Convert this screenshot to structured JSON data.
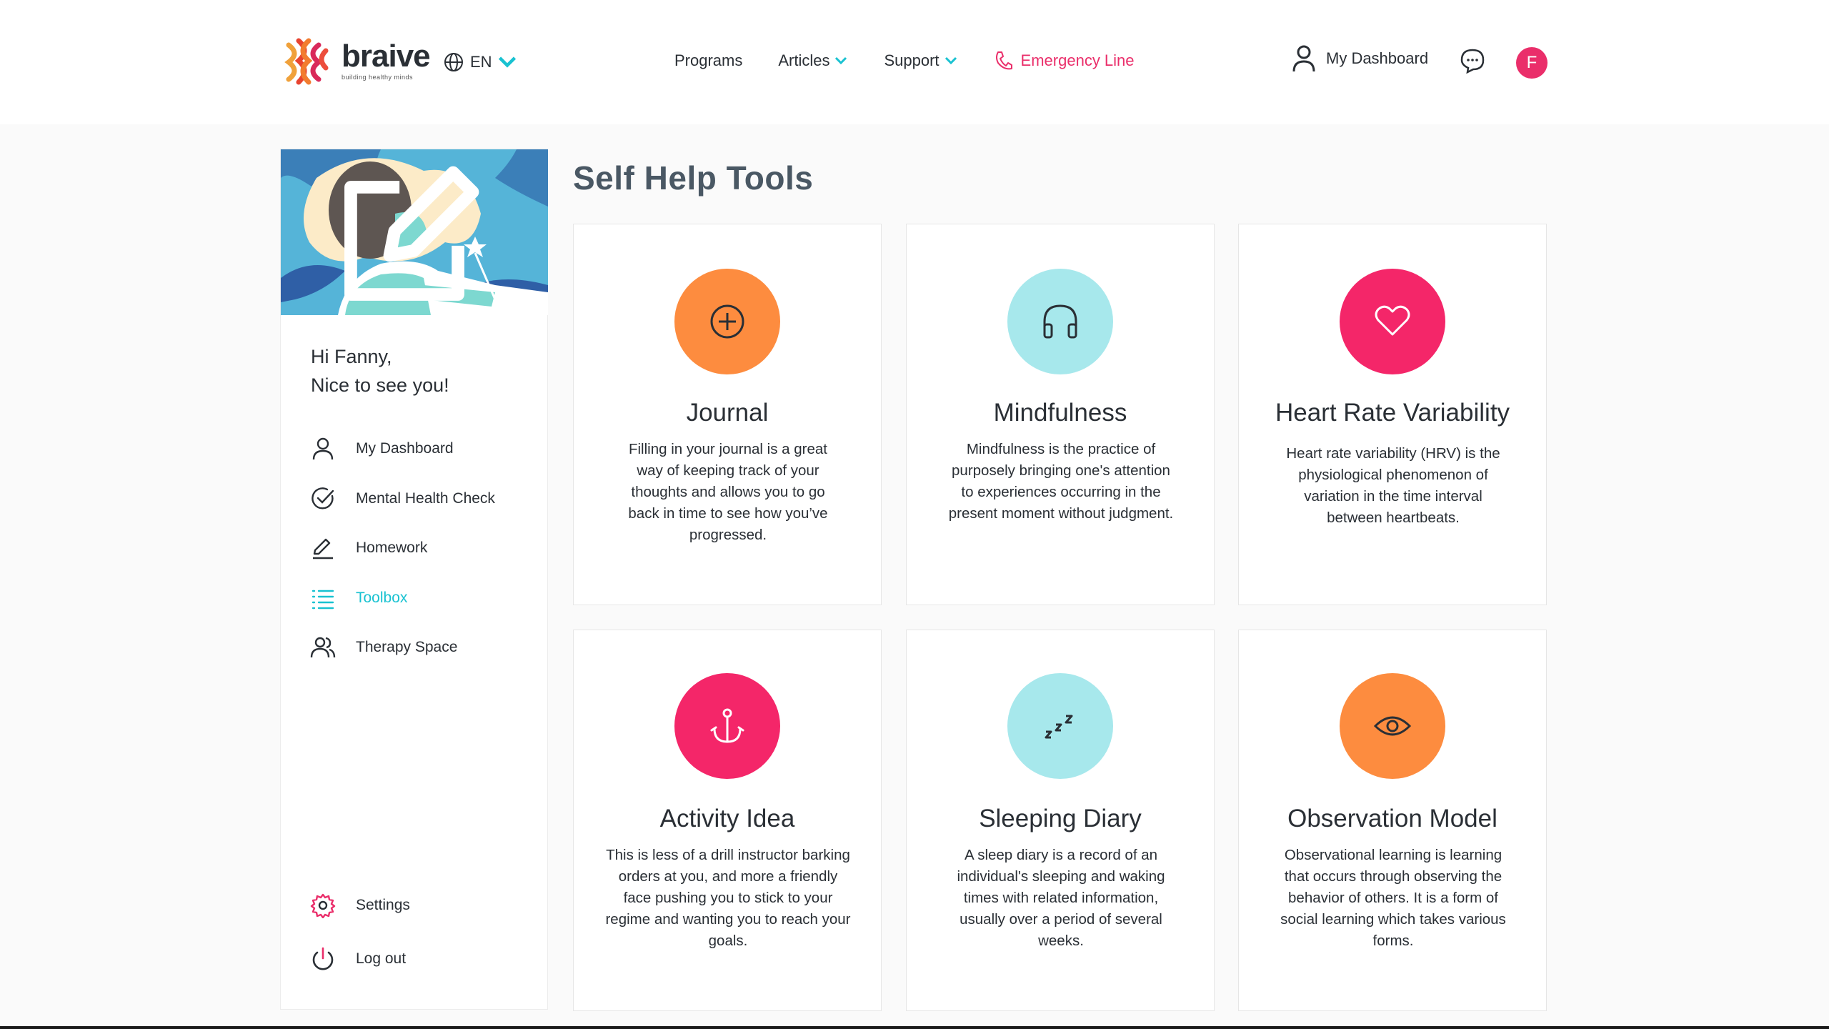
{
  "header": {
    "logo_name": "braive",
    "logo_tagline": "building healthy minds",
    "language": "EN",
    "nav": {
      "programs": "Programs",
      "articles": "Articles",
      "support": "Support",
      "emergency": "Emergency Line"
    },
    "my_dashboard": "My Dashboard",
    "avatar_initial": "F"
  },
  "sidebar": {
    "greeting_line1": "Hi Fanny,",
    "greeting_line2": "Nice to see you!",
    "items": [
      {
        "label": "My Dashboard",
        "icon": "user-icon"
      },
      {
        "label": "Mental Health Check",
        "icon": "check-circle-icon"
      },
      {
        "label": "Homework",
        "icon": "pencil-icon"
      },
      {
        "label": "Toolbox",
        "icon": "list-icon",
        "active": true
      },
      {
        "label": "Therapy Space",
        "icon": "users-icon"
      }
    ],
    "settings": "Settings",
    "logout": "Log out"
  },
  "main": {
    "title": "Self Help Tools",
    "cards": [
      {
        "title": "Journal",
        "description": "Filling in your journal is a great way of keeping track of your thoughts and allows you to go back in time to see how you’ve progressed.",
        "icon": "plus-circle-icon",
        "color": "#fd8c3f"
      },
      {
        "title": "Mindfulness",
        "description": "Mindfulness is the practice of purposely bringing one's attention to experiences occurring in the present moment without judgment.",
        "icon": "headphones-icon",
        "color": "#a7e8ec"
      },
      {
        "title": "Heart Rate Variability",
        "description": "Heart rate variability (HRV) is the physiological phenomenon of variation in the time interval between heartbeats.",
        "icon": "heart-icon",
        "color": "#f42669"
      },
      {
        "title": "Activity Idea",
        "description": "This is less of a drill instructor barking orders at you, and more a friendly face pushing you to stick to your regime and wanting you to reach your goals.",
        "icon": "anchor-icon",
        "color": "#f42669"
      },
      {
        "title": "Sleeping Diary",
        "description": "A sleep diary is a record of an individual's sleeping and waking times with related information, usually over a period of several weeks.",
        "icon": "zzz-icon",
        "color": "#a7e8ec"
      },
      {
        "title": "Observation Model",
        "description": "Observational learning is learning that occurs through observing the behavior of others. It is a form of social learning which takes various forms.",
        "icon": "eye-icon",
        "color": "#fd8c3f"
      }
    ]
  },
  "colors": {
    "accent_pink": "#ea2e6a",
    "accent_teal": "#19c2d1",
    "orange": "#fd8c3f"
  }
}
